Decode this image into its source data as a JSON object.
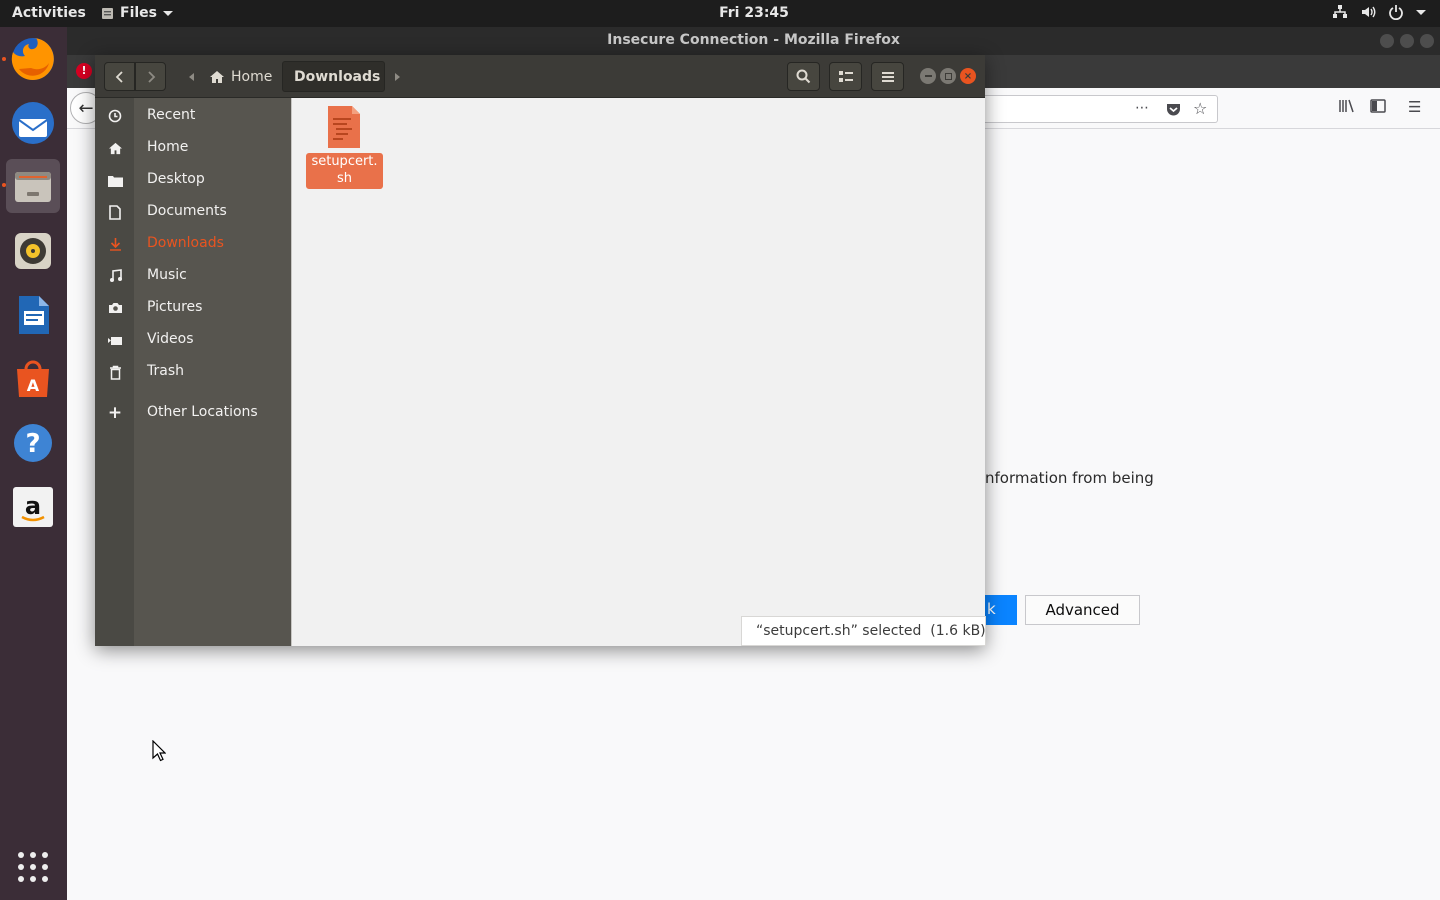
{
  "topbar": {
    "activities": "Activities",
    "app_menu": "Files",
    "clock": "Fri 23:45"
  },
  "dock": {
    "items": [
      "firefox-icon",
      "thunderbird-icon",
      "files-icon",
      "rhythmbox-icon",
      "libreoffice-writer-icon",
      "software-center-icon",
      "help-icon",
      "amazon-icon",
      "show-apps-icon"
    ]
  },
  "firefox": {
    "title": "Insecure Connection - Mozilla Firefox",
    "error_text_fragment": "nformation from being",
    "go_back_fragment": "k",
    "advanced_label": "Advanced",
    "accent": "#0a84ff"
  },
  "nautilus": {
    "breadcrumb": {
      "home": "Home",
      "current": "Downloads"
    },
    "sidebar": {
      "items": [
        {
          "label": "Recent",
          "icon": "clock-icon"
        },
        {
          "label": "Home",
          "icon": "home-icon"
        },
        {
          "label": "Desktop",
          "icon": "folder-icon"
        },
        {
          "label": "Documents",
          "icon": "document-icon"
        },
        {
          "label": "Downloads",
          "icon": "download-icon"
        },
        {
          "label": "Music",
          "icon": "music-icon"
        },
        {
          "label": "Pictures",
          "icon": "camera-icon"
        },
        {
          "label": "Videos",
          "icon": "video-icon"
        },
        {
          "label": "Trash",
          "icon": "trash-icon"
        },
        {
          "label": "Other Locations",
          "icon": "plus-icon"
        }
      ],
      "selected": "Downloads"
    },
    "files": [
      {
        "name_line1": "setupcert.",
        "name_line2": "sh"
      }
    ],
    "status": "“setupcert.sh” selected  (1.6 kB)",
    "accent": "#e95420"
  }
}
